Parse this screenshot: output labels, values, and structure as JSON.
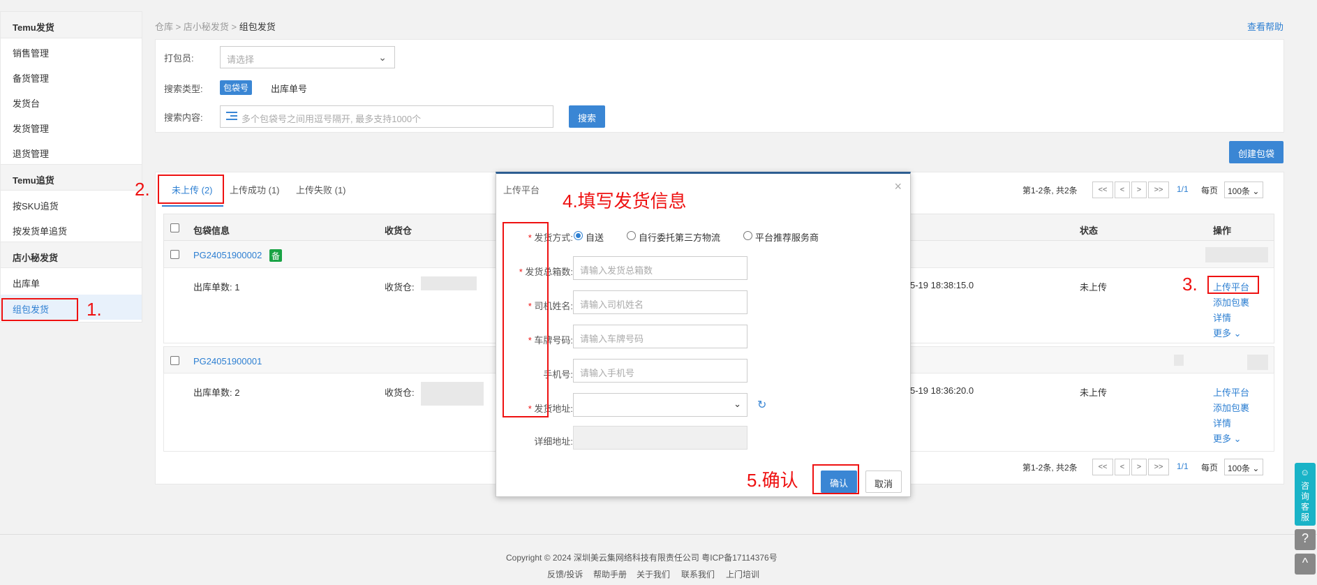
{
  "sidebar": {
    "groups": [
      "Temu发货",
      "Temu追货",
      "店小秘发货"
    ],
    "items": [
      "销售管理",
      "备货管理",
      "发货台",
      "发货管理",
      "退货管理",
      "按SKU追货",
      "按发货单追货",
      "出库单",
      "组包发货"
    ]
  },
  "annotations": {
    "step1": "1.",
    "step2": "2.",
    "step3": "3.",
    "step4": "4.填写发货信息",
    "step5": "5.确认"
  },
  "breadcrumb": {
    "p1": "仓库",
    "p2": "店小秘发货",
    "current": "组包发货",
    "sep": ">"
  },
  "help_link": "查看帮助",
  "filter": {
    "packer_label": "打包员:",
    "packer_placeholder": "请选择",
    "search_type_label": "搜索类型:",
    "search_type_active": "包袋号",
    "search_type_other": "出库单号",
    "search_content_label": "搜索内容:",
    "search_placeholder": "多个包袋号之间用逗号隔开, 最多支持1000个",
    "search_button": "搜索"
  },
  "create_button": "创建包袋",
  "tabs": [
    "未上传 (2)",
    "上传成功 (1)",
    "上传失败 (1)"
  ],
  "pager": {
    "summary": "第1-2条, 共2条",
    "first": "<<",
    "prev": "<",
    "next": ">",
    "last": ">>",
    "page": "1/1",
    "per_page_label": "每页",
    "per_page": "100条"
  },
  "table": {
    "headers": [
      "包袋信息",
      "收货仓",
      "状态",
      "操作"
    ],
    "rows": [
      {
        "id": "PG24051900002",
        "badge": "备",
        "count": "出库单数: 1",
        "warehouse": "收货仓:",
        "time": "5-19 18:38:15.0",
        "status": "未上传"
      },
      {
        "id": "PG24051900001",
        "badge": "",
        "count": "出库单数: 2",
        "warehouse": "收货仓:",
        "time": "5-19 18:36:20.0",
        "status": "未上传"
      }
    ],
    "actions": [
      "上传平台",
      "添加包裹",
      "详情",
      "更多"
    ]
  },
  "modal": {
    "title": "上传平台",
    "close": "×",
    "method_label": "发货方式:",
    "method_options": [
      "自送",
      "自行委托第三方物流",
      "平台推荐服务商"
    ],
    "boxes_label": "发货总箱数:",
    "boxes_placeholder": "请输入发货总箱数",
    "driver_label": "司机姓名:",
    "driver_placeholder": "请输入司机姓名",
    "plate_label": "车牌号码:",
    "plate_placeholder": "请输入车牌号码",
    "phone_label": "手机号:",
    "phone_placeholder": "请输入手机号",
    "address_label": "发货地址:",
    "detail_address_label": "详细地址:",
    "req_mark": "*",
    "confirm": "确认",
    "cancel": "取消"
  },
  "footer": {
    "copyright": "Copyright © 2024 深圳美云集网络科技有限责任公司  粤ICP备17114376号",
    "links": [
      "反馈/投诉",
      "帮助手册",
      "关于我们",
      "联系我们",
      "上门培训"
    ]
  },
  "float": {
    "service": "咨询客服",
    "help": "?",
    "top": "^"
  },
  "colors": {
    "primary": "#3a86d4",
    "annotation": "#ee1111",
    "badge": "#19a345",
    "modal_top": "#2d5e91"
  }
}
